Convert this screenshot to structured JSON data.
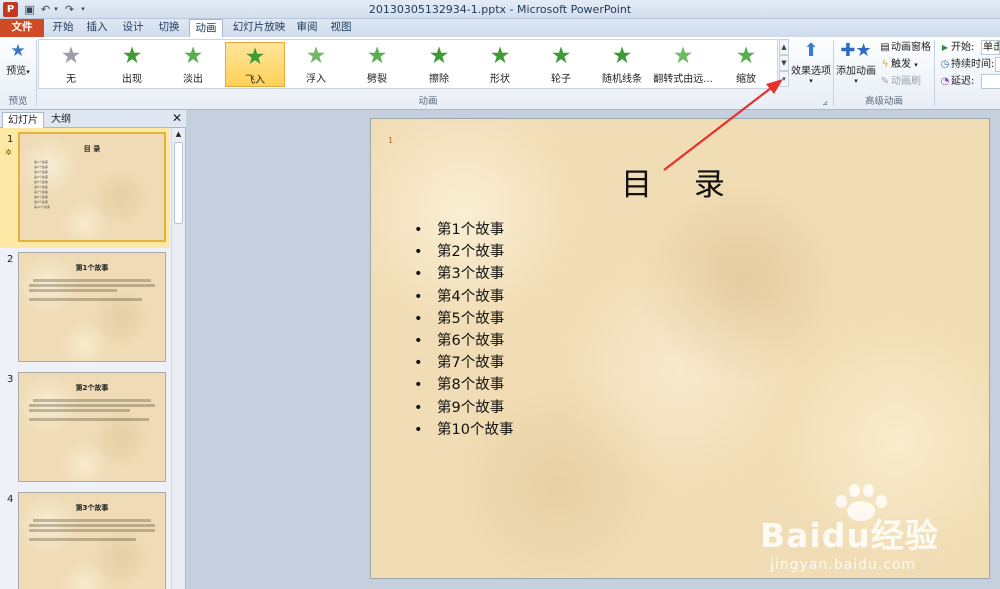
{
  "window": {
    "app_icon": "P",
    "title": "20130305132934-1.pptx - Microsoft PowerPoint"
  },
  "tabs": [
    {
      "label": "文件"
    },
    {
      "label": "开始"
    },
    {
      "label": "插入"
    },
    {
      "label": "设计"
    },
    {
      "label": "切换"
    },
    {
      "label": "动画"
    },
    {
      "label": "幻灯片放映"
    },
    {
      "label": "审阅"
    },
    {
      "label": "视图"
    }
  ],
  "ribbon": {
    "preview": {
      "label": "预览",
      "group": "预览"
    },
    "animation_group": "动画",
    "effects": [
      {
        "label": "无",
        "color": "#9aa0a6"
      },
      {
        "label": "出现",
        "color": "#3f9a35"
      },
      {
        "label": "淡出",
        "color": "#57b04c"
      },
      {
        "label": "飞入",
        "color": "#3f9a35"
      },
      {
        "label": "浮入",
        "color": "#6dbb62"
      },
      {
        "label": "劈裂",
        "color": "#57b04c"
      },
      {
        "label": "擦除",
        "color": "#3f9a35"
      },
      {
        "label": "形状",
        "color": "#3f9a35"
      },
      {
        "label": "轮子",
        "color": "#3f9a35"
      },
      {
        "label": "随机线条",
        "color": "#3f9a35"
      },
      {
        "label": "翻转式由远...",
        "color": "#6dbb62"
      },
      {
        "label": "缩放",
        "color": "#57b04c"
      }
    ],
    "selected_effect": "飞入",
    "effect_options": "效果选项",
    "add_animation": "添加动画",
    "animation_pane": "动画窗格",
    "trigger": "触发",
    "animation_painter": "动画刷",
    "advanced_group": "高级动画",
    "start_label": "开始:",
    "start_value": "单击",
    "duration_label": "持续时间:",
    "delay_label": "延迟:"
  },
  "pane": {
    "tab_slides": "幻灯片",
    "tab_outline": "大纲",
    "close": "✕"
  },
  "thumbnails": [
    {
      "num": "1",
      "title": "目 录",
      "list": [
        "第1个故事",
        "第2个故事",
        "第3个故事",
        "第4个故事",
        "第5个故事",
        "第6个故事",
        "第7个故事",
        "第8个故事",
        "第9个故事",
        "第10个故事"
      ]
    },
    {
      "num": "2",
      "title": "第1个故事"
    },
    {
      "num": "3",
      "title": "第2个故事"
    },
    {
      "num": "4",
      "title": "第3个故事"
    }
  ],
  "slide": {
    "title": "目 录",
    "items": [
      "第1个故事",
      "第2个故事",
      "第3个故事",
      "第4个故事",
      "第5个故事",
      "第6个故事",
      "第7个故事",
      "第8个故事",
      "第9个故事",
      "第10个故事"
    ]
  },
  "watermark": {
    "brand": "Baidu经验",
    "url": "jingyan.baidu.com"
  },
  "colors": {
    "file_tab": "#d04a25",
    "arrow": "#e8302a",
    "selection": "#ffd15a"
  }
}
